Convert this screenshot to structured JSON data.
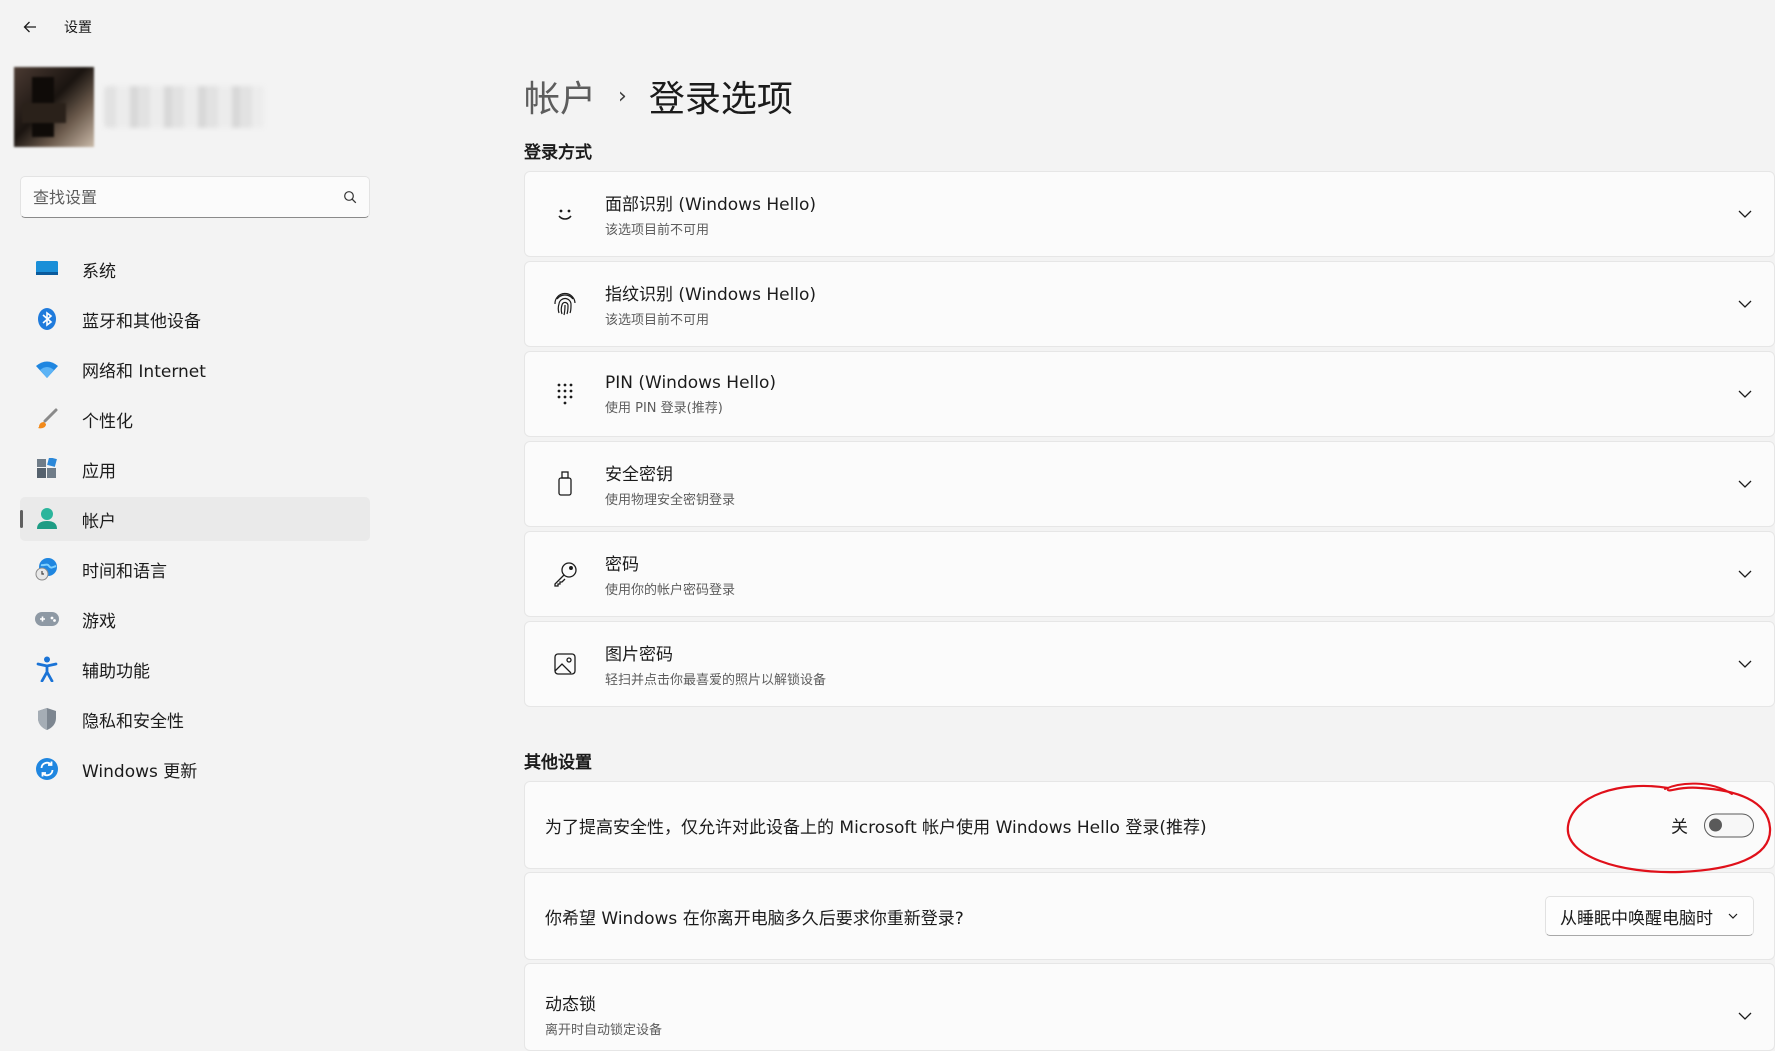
{
  "titlebar": {
    "app_title": "设置"
  },
  "search": {
    "placeholder": "查找设置"
  },
  "nav": {
    "items": [
      {
        "label": "系统",
        "icon": "monitor-icon"
      },
      {
        "label": "蓝牙和其他设备",
        "icon": "bluetooth-icon"
      },
      {
        "label": "网络和 Internet",
        "icon": "wifi-icon"
      },
      {
        "label": "个性化",
        "icon": "brush-icon"
      },
      {
        "label": "应用",
        "icon": "apps-icon"
      },
      {
        "label": "帐户",
        "icon": "account-icon",
        "selected": true
      },
      {
        "label": "时间和语言",
        "icon": "globe-clock-icon"
      },
      {
        "label": "游戏",
        "icon": "gamepad-icon"
      },
      {
        "label": "辅助功能",
        "icon": "accessibility-icon"
      },
      {
        "label": "隐私和安全性",
        "icon": "shield-icon"
      },
      {
        "label": "Windows 更新",
        "icon": "update-icon"
      }
    ]
  },
  "breadcrumb": {
    "parent": "帐户",
    "separator": "›",
    "current": "登录选项"
  },
  "sections": {
    "signin_methods": "登录方式",
    "other_settings": "其他设置"
  },
  "signin_methods": [
    {
      "title": "面部识别 (Windows Hello)",
      "subtitle": "该选项目前不可用",
      "icon": "face-icon"
    },
    {
      "title": "指纹识别 (Windows Hello)",
      "subtitle": "该选项目前不可用",
      "icon": "fingerprint-icon"
    },
    {
      "title": "PIN (Windows Hello)",
      "subtitle": "使用 PIN 登录(推荐)",
      "icon": "pin-keypad-icon"
    },
    {
      "title": "安全密钥",
      "subtitle": "使用物理安全密钥登录",
      "icon": "usb-key-icon"
    },
    {
      "title": "密码",
      "subtitle": "使用你的帐户密码登录",
      "icon": "key-icon"
    },
    {
      "title": "图片密码",
      "subtitle": "轻扫并点击你最喜爱的照片以解锁设备",
      "icon": "picture-icon"
    }
  ],
  "other_settings": {
    "hello_only": {
      "label": "为了提高安全性，仅允许对此设备上的 Microsoft 帐户使用 Windows Hello 登录(推荐)",
      "state_label": "关",
      "on": false
    },
    "require_signin": {
      "label": "你希望 Windows 在你离开电脑多久后要求你重新登录?",
      "selected_option": "从睡眠中唤醒电脑时"
    },
    "dynamic_lock": {
      "title": "动态锁",
      "subtitle": "离开时自动锁定设备"
    }
  },
  "colors": {
    "accent": "#0067c0",
    "annotation_red": "#e0101a"
  }
}
